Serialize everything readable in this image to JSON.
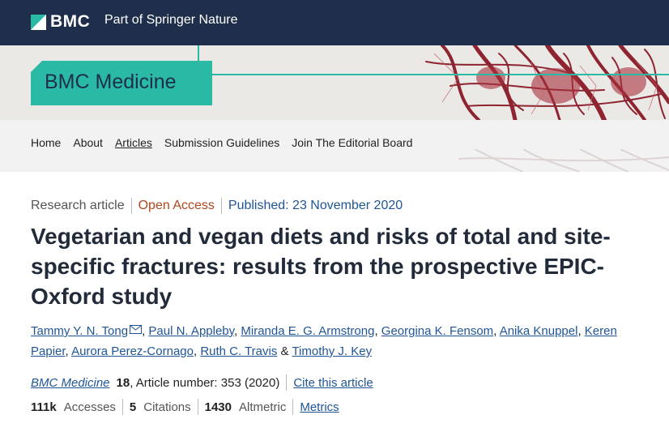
{
  "brand": {
    "logo_text": "BMC",
    "tagline": "Part of Springer Nature"
  },
  "journal": {
    "title": "BMC Medicine"
  },
  "nav": {
    "items": [
      {
        "label": "Home"
      },
      {
        "label": "About"
      },
      {
        "label": "Articles",
        "active": true
      },
      {
        "label": "Submission Guidelines"
      },
      {
        "label": "Join The Editorial Board"
      }
    ]
  },
  "article": {
    "type": "Research article",
    "access": "Open Access",
    "published": "Published: 23 November 2020",
    "title": "Vegetarian and vegan diets and risks of total and site-specific fractures: results from the prospective EPIC-Oxford study",
    "authors": [
      {
        "name": "Tammy Y. N. Tong",
        "sep": ", ",
        "mail": true
      },
      {
        "name": "Paul N. Appleby",
        "sep": ", "
      },
      {
        "name": "Miranda E. G. Armstrong",
        "sep": ", "
      },
      {
        "name": "Georgina K. Fensom",
        "sep": ", "
      },
      {
        "name": "Anika Knuppel",
        "sep": ", "
      },
      {
        "name": "Keren Papier",
        "sep": ", "
      },
      {
        "name": "Aurora Perez-Cornago",
        "sep": ", "
      },
      {
        "name": "Ruth C. Travis",
        "sep": " & "
      },
      {
        "name": "Timothy J. Key",
        "sep": ""
      }
    ],
    "citation": {
      "journal": "BMC Medicine",
      "volume": "18",
      "article_number": ", Article number: 353 (2020)",
      "cite_link": "Cite this article"
    },
    "metrics": {
      "accesses_value": "111k",
      "accesses_label": "Accesses",
      "citations_value": "5",
      "citations_label": "Citations",
      "altmetric_value": "1430",
      "altmetric_label": "Altmetric",
      "metrics_link": "Metrics"
    }
  },
  "colors": {
    "brand_navy": "#1f2f4b",
    "teal": "#29b9a4",
    "link_blue": "#1f5597",
    "open_access": "#b0461c"
  },
  "icons": {
    "bmc_mark": "bmc-logo-icon",
    "mail": "envelope-icon",
    "hero": "vascular-illustration"
  }
}
